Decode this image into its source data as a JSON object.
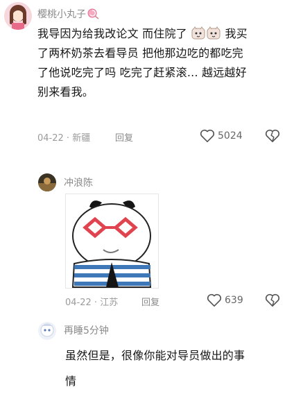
{
  "comments": [
    {
      "username": "樱桃小丸子",
      "text_lines": [
        "我导因为给我改论文 而住院了",
        "我买",
        "了两杯奶茶去看导员 把他那边吃的都吃完",
        "了他说吃完了吗 吃完了赶紧滚... 越远越好",
        "别来看我。"
      ],
      "date": "04-22",
      "location": "新疆",
      "reply_label": "回复",
      "like_count": "5024"
    },
    {
      "username": "冲浪陈",
      "date": "04-22",
      "location": "江苏",
      "reply_label": "回复",
      "like_count": "639"
    },
    {
      "username": "再睡5分钟",
      "text_lines": [
        "虽然但是，很像你能对导员做出的事",
        "情"
      ]
    }
  ],
  "separator": "·",
  "icons": {
    "heart": "heart-outline-icon",
    "dislike": "broken-heart-icon",
    "sticker": "panda-glasses-sticker"
  },
  "colors": {
    "username": "#8a8a8a",
    "meta": "#9a9a9a",
    "text": "#161616",
    "sticker_glasses": "#e0454f",
    "sticker_shirt": "#3e78b8"
  }
}
